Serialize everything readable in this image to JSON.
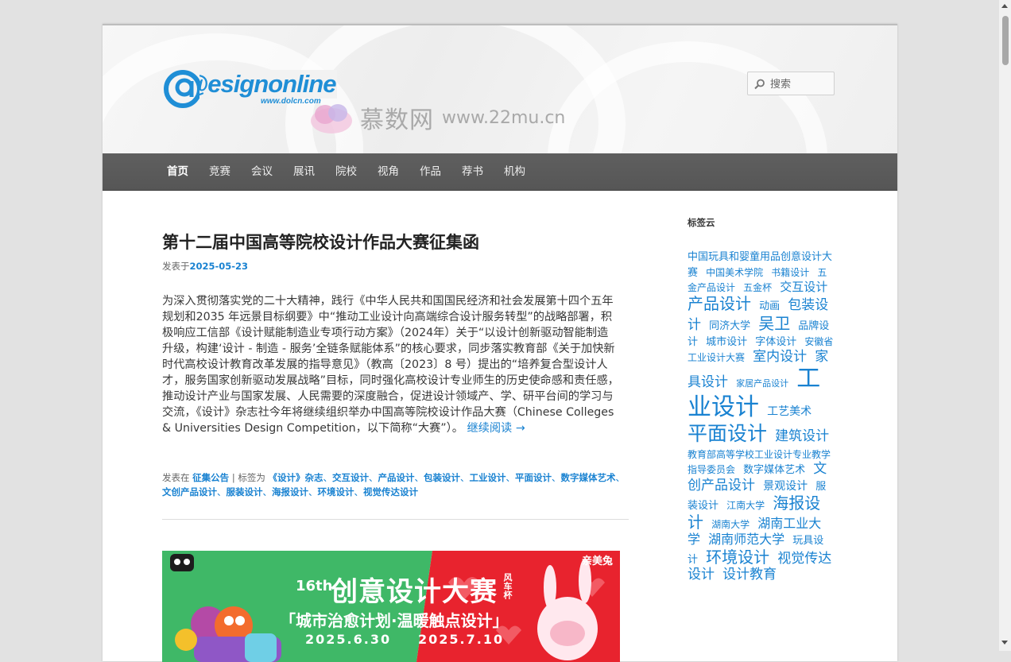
{
  "site": {
    "logo_main": "@esignonline",
    "logo_url": "www.dolcn.com",
    "watermark_cn": "慕数网",
    "watermark_url": "www.22mu.cn"
  },
  "search": {
    "placeholder": "搜索"
  },
  "nav": [
    {
      "label": "首页"
    },
    {
      "label": "竞赛"
    },
    {
      "label": "会议"
    },
    {
      "label": "展讯"
    },
    {
      "label": "院校"
    },
    {
      "label": "视角"
    },
    {
      "label": "作品"
    },
    {
      "label": "荐书"
    },
    {
      "label": "机构"
    }
  ],
  "post": {
    "title": "第十二届中国高等院校设计作品大赛征集函",
    "meta_prefix": "发表于",
    "date": "2025-05-23",
    "body": "为深入贯彻落实党的二十大精神，践行《中华人民共和国国民经济和社会发展第十四个五年规划和2035 年远景目标纲要》中“推动工业设计向高端综合设计服务转型”的战略部署，积极响应工信部《设计赋能制造业专项行动方案》（2024年）关于“以设计创新驱动智能制造升级，构建‘设计 - 制造 - 服务’全链条赋能体系”的核心要求，同步落实教育部《关于加快新时代高校设计教育改革发展的指导意见》（教高〔2023〕8 号）提出的“培养复合型设计人才，服务国家创新驱动发展战略”目标，同时强化高校设计专业师生的历史使命感和责任感，推动设计产业与国家发展、人民需要的深度融合，促进设计领域产、学、研平台间的学习与交流，《设计》杂志社今年将继续组织举办中国高等院校设计作品大赛（Chinese Colleges & Universities Design Competition，以下简称“大赛”）。",
    "read_more": "继续阅读 →",
    "footer_posted_in": "发表在",
    "category": "征集公告",
    "footer_tagged": "| 标签为",
    "tags": [
      "《设计》杂志",
      "交互设计",
      "产品设计",
      "包装设计",
      "工业设计",
      "平面设计",
      "数字媒体艺术",
      "文创产品设计",
      "服装设计",
      "海报设计",
      "环境设计",
      "视觉传达设计"
    ]
  },
  "banner": {
    "edition": "16th",
    "title": "创意设计大赛",
    "cup": "风车杯",
    "subtitle": "「城市治愈计划·温暖触点设计」",
    "date_start": "2025.6.30",
    "date_end": "2025.7.10",
    "brand": "亲美兔"
  },
  "sidebar": {
    "title": "标签云",
    "tags": [
      {
        "name": "中国玩具和婴童用品创意设计大赛",
        "size": 13
      },
      {
        "name": "中国美术学院",
        "size": 12
      },
      {
        "name": "书籍设计",
        "size": 12
      },
      {
        "name": "五金产品设计",
        "size": 12
      },
      {
        "name": "五金杯",
        "size": 12
      },
      {
        "name": "交互设计",
        "size": 15
      },
      {
        "name": "产品设计",
        "size": 20
      },
      {
        "name": "动画",
        "size": 13
      },
      {
        "name": "包装设计",
        "size": 17
      },
      {
        "name": "同济大学",
        "size": 13
      },
      {
        "name": "吴卫",
        "size": 20
      },
      {
        "name": "品牌设计",
        "size": 13
      },
      {
        "name": "城市设计",
        "size": 13
      },
      {
        "name": "字体设计",
        "size": 13
      },
      {
        "name": "安徽省工业设计大赛",
        "size": 12
      },
      {
        "name": "室内设计",
        "size": 17
      },
      {
        "name": "家具设计",
        "size": 17
      },
      {
        "name": "家居产品设计",
        "size": 11
      },
      {
        "name": "工业设计",
        "size": 30
      },
      {
        "name": "工艺美术",
        "size": 14
      },
      {
        "name": "平面设计",
        "size": 25
      },
      {
        "name": "建筑设计",
        "size": 17
      },
      {
        "name": "教育部高等学校工业设计专业教学指导委员会",
        "size": 12
      },
      {
        "name": "数字媒体艺术",
        "size": 13
      },
      {
        "name": "文创产品设计",
        "size": 17
      },
      {
        "name": "景观设计",
        "size": 14
      },
      {
        "name": "服装设计",
        "size": 13
      },
      {
        "name": "江南大学",
        "size": 12
      },
      {
        "name": "海报设计",
        "size": 20
      },
      {
        "name": "湖南大学",
        "size": 12
      },
      {
        "name": "湖南工业大学",
        "size": 16
      },
      {
        "name": "湖南师范大学",
        "size": 16
      },
      {
        "name": "玩具设计",
        "size": 13
      },
      {
        "name": "环境设计",
        "size": 20
      },
      {
        "name": "视觉传达设计",
        "size": 17
      },
      {
        "name": "设计教育",
        "size": 17
      }
    ]
  },
  "colors": {
    "link": "#1982d1",
    "nav_bg": "#5a5a5a",
    "banner_green": "#3fb867",
    "banner_red": "#e8232e"
  }
}
